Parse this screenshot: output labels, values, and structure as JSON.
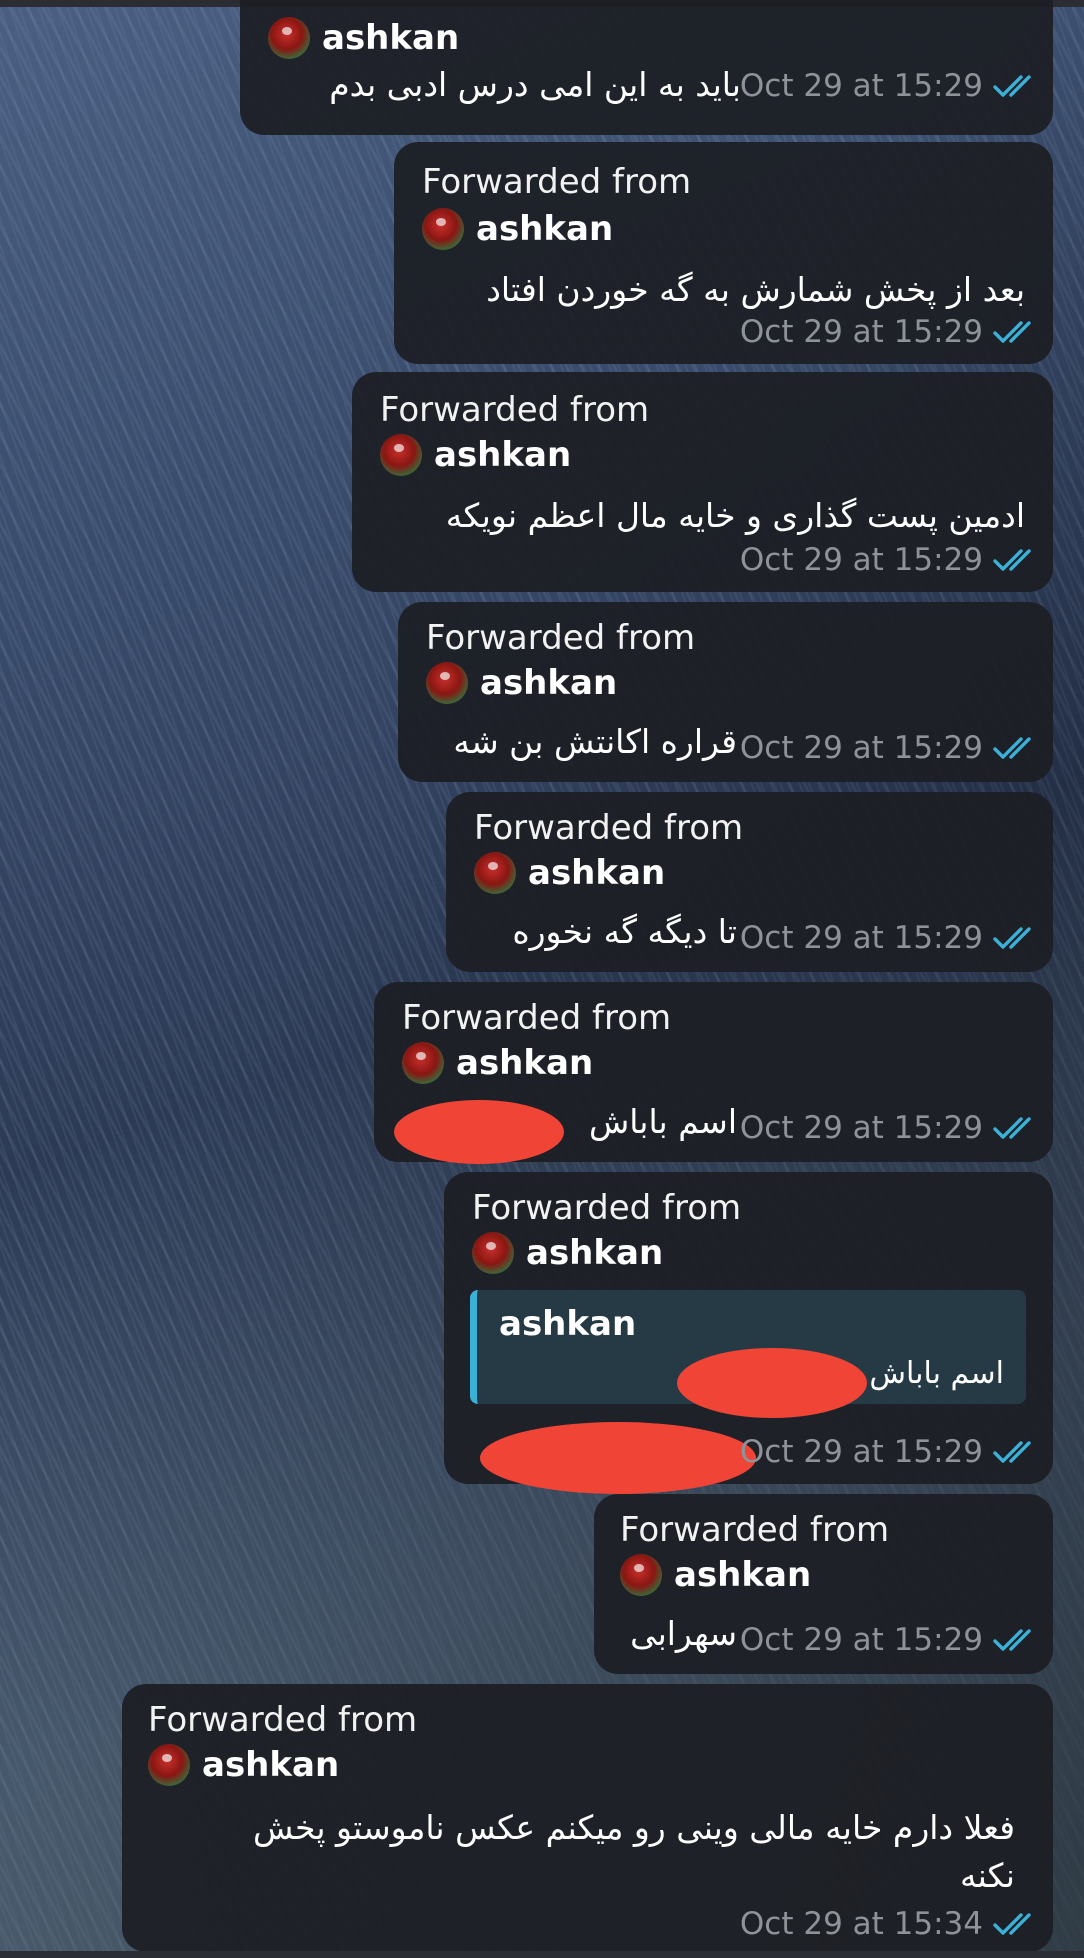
{
  "forward_label": "Forwarded from",
  "sender_name": "ashkan",
  "colors": {
    "bubble": "#1c1e24",
    "timestamp": "#8e9399",
    "checks": "#3cb1d8",
    "quote_accent": "#3cb1d8",
    "redaction": "#f04436"
  },
  "messages": [
    {
      "text": "باید به این امی درس ادبی بدم",
      "time": "Oct 29 at 15:29"
    },
    {
      "text": "بعد از پخش شمارش به گه خوردن افتاد",
      "time": "Oct 29 at 15:29"
    },
    {
      "text": "ادمین پست گذاری و خایه مال اعظم نویکه",
      "time": "Oct 29 at 15:29"
    },
    {
      "text": "قراره اکانتش بن شه",
      "time": "Oct 29 at 15:29"
    },
    {
      "text": "تا دیگه گه نخوره",
      "time": "Oct 29 at 15:29"
    },
    {
      "text": "اسم باباش",
      "time": "Oct 29 at 15:29"
    },
    {
      "quote_sender": "ashkan",
      "quote_text": "اسم باباش",
      "time": "Oct 29 at 15:29"
    },
    {
      "text": "سهرابی",
      "time": "Oct 29 at 15:29"
    },
    {
      "text_line1": "فعلا دارم خایه مالی وینی رو میکنم عکس ناموستو پخش",
      "text_line2": "نکنه",
      "time": "Oct 29 at 15:34"
    }
  ]
}
